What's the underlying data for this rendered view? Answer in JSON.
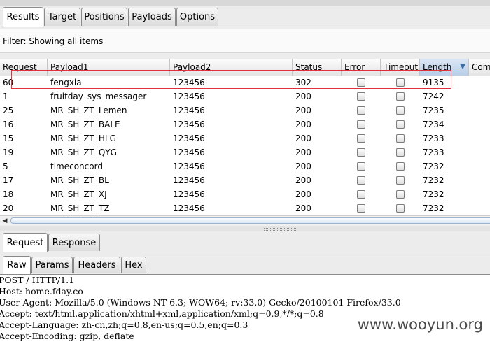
{
  "top_tabs": [
    "Results",
    "Target",
    "Positions",
    "Payloads",
    "Options"
  ],
  "active_top_tab": "Results",
  "filter": {
    "text": "Filter: Showing all items"
  },
  "table": {
    "columns": [
      "Request",
      "Payload1",
      "Payload2",
      "Status",
      "Error",
      "Timeout",
      "Length",
      "Com"
    ],
    "sorted_column": "Length",
    "sort_indicator": "▼",
    "rows": [
      {
        "request": "60",
        "payload1": "fengxia",
        "payload2": "123456",
        "status": "302",
        "length": "9135"
      },
      {
        "request": "1",
        "payload1": "fruitday_sys_messager",
        "payload2": "123456",
        "status": "200",
        "length": "7242"
      },
      {
        "request": "25",
        "payload1": "MR_SH_ZT_Lemen",
        "payload2": "123456",
        "status": "200",
        "length": "7235"
      },
      {
        "request": "16",
        "payload1": "MR_SH_ZT_BALE",
        "payload2": "123456",
        "status": "200",
        "length": "7234"
      },
      {
        "request": "15",
        "payload1": "MR_SH_ZT_HLG",
        "payload2": "123456",
        "status": "200",
        "length": "7233"
      },
      {
        "request": "19",
        "payload1": "MR_SH_ZT_QYG",
        "payload2": "123456",
        "status": "200",
        "length": "7233"
      },
      {
        "request": "5",
        "payload1": "timeconcord",
        "payload2": "123456",
        "status": "200",
        "length": "7232"
      },
      {
        "request": "17",
        "payload1": "MR_SH_ZT_BL",
        "payload2": "123456",
        "status": "200",
        "length": "7232"
      },
      {
        "request": "18",
        "payload1": "MR_SH_ZT_XJ",
        "payload2": "123456",
        "status": "200",
        "length": "7232"
      },
      {
        "request": "20",
        "payload1": "MR_SH_ZT_TZ",
        "payload2": "123456",
        "status": "200",
        "length": "7232"
      }
    ]
  },
  "message_tabs": [
    "Request",
    "Response"
  ],
  "active_message_tab": "Request",
  "view_tabs": [
    "Raw",
    "Params",
    "Headers",
    "Hex"
  ],
  "active_view_tab": "Raw",
  "request_lines": [
    "POST / HTTP/1.1",
    "Host: home.fday.co",
    "User-Agent: Mozilla/5.0 (Windows NT 6.3; WOW64; rv:33.0) Gecko/20100101 Firefox/33.0",
    "Accept: text/html,application/xhtml+xml,application/xml;q=0.9,*/*;q=0.8",
    "Accept-Language: zh-cn,zh;q=0.8,en-us;q=0.5,en;q=0.3",
    "Accept-Encoding: gzip, deflate"
  ],
  "watermark": "www.wooyun.org",
  "colors": {
    "highlight_border": "#e0303a",
    "sorted_header": "#b9cfe8"
  }
}
